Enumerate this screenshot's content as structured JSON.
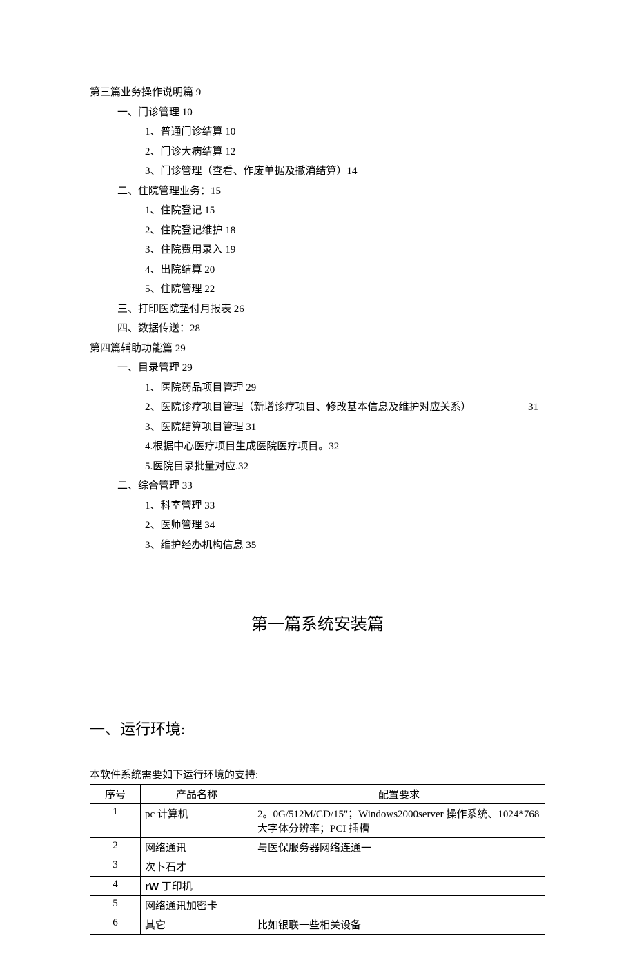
{
  "toc": {
    "part3": "第三篇业务操作说明篇 9",
    "p3_s1": "一、门诊管理 10",
    "p3_s1_1": "1、普通门诊结算 10",
    "p3_s1_2": "2、门诊大病结算 12",
    "p3_s1_3": "3、门诊管理（查看、作废单据及撤消结算）14",
    "p3_s2": "二、住院管理业务：15",
    "p3_s2_1": "1、住院登记 15",
    "p3_s2_2": "2、住院登记维护 18",
    "p3_s2_3": "3、住院费用录入 19",
    "p3_s2_4": "4、出院结算 20",
    "p3_s2_5": "5、住院管理 22",
    "p3_s3": "三、打印医院垫付月报表 26",
    "p3_s4": "四、数据传送：28",
    "part4": "第四篇辅助功能篇 29",
    "p4_s1": "一、目录管理 29",
    "p4_s1_1": "1、医院药品项目管理 29",
    "p4_s1_2": "2、医院诊疗项目管理（新增诊疗项目、修改基本信息及维护对应关系）",
    "p4_s1_2_page": "31",
    "p4_s1_3": "3、医院结算项目管理 31",
    "p4_s1_4": "4.根据中心医疗项目生成医院医疗项目。32",
    "p4_s1_5": "5.医院目录批量对应.32",
    "p4_s2": "二、综合管理 33",
    "p4_s2_1": "1、科室管理 33",
    "p4_s2_2": "2、医师管理 34",
    "p4_s2_3": "3、维护经办机构信息 35"
  },
  "chapter_title": "第一篇系统安装篇",
  "section_title": "一、运行环境:",
  "table_intro": "本软件系统需要如下运行环境的支持:",
  "table": {
    "headers": {
      "col1": "序号",
      "col2": "产品名称",
      "col3": "配置要求"
    },
    "rows": [
      {
        "num": "1",
        "prod": "pc 计算机",
        "req": "2。0G/512M/CD/15\"；Windows2000server 操作系统、1024*768 大字体分辨率；PCI 插槽"
      },
      {
        "num": "2",
        "prod": "网络通讯",
        "req": "与医保服务器网络连通一"
      },
      {
        "num": "3",
        "prod": "次卜石才",
        "req": ""
      },
      {
        "num": "4",
        "prod_prefix": "rW",
        "prod_suffix": " 丁印机",
        "req": ""
      },
      {
        "num": "5",
        "prod": "网络通讯加密卡",
        "req": ""
      },
      {
        "num": "6",
        "prod": "其它",
        "req": "比如银联一些相关设备"
      }
    ]
  }
}
